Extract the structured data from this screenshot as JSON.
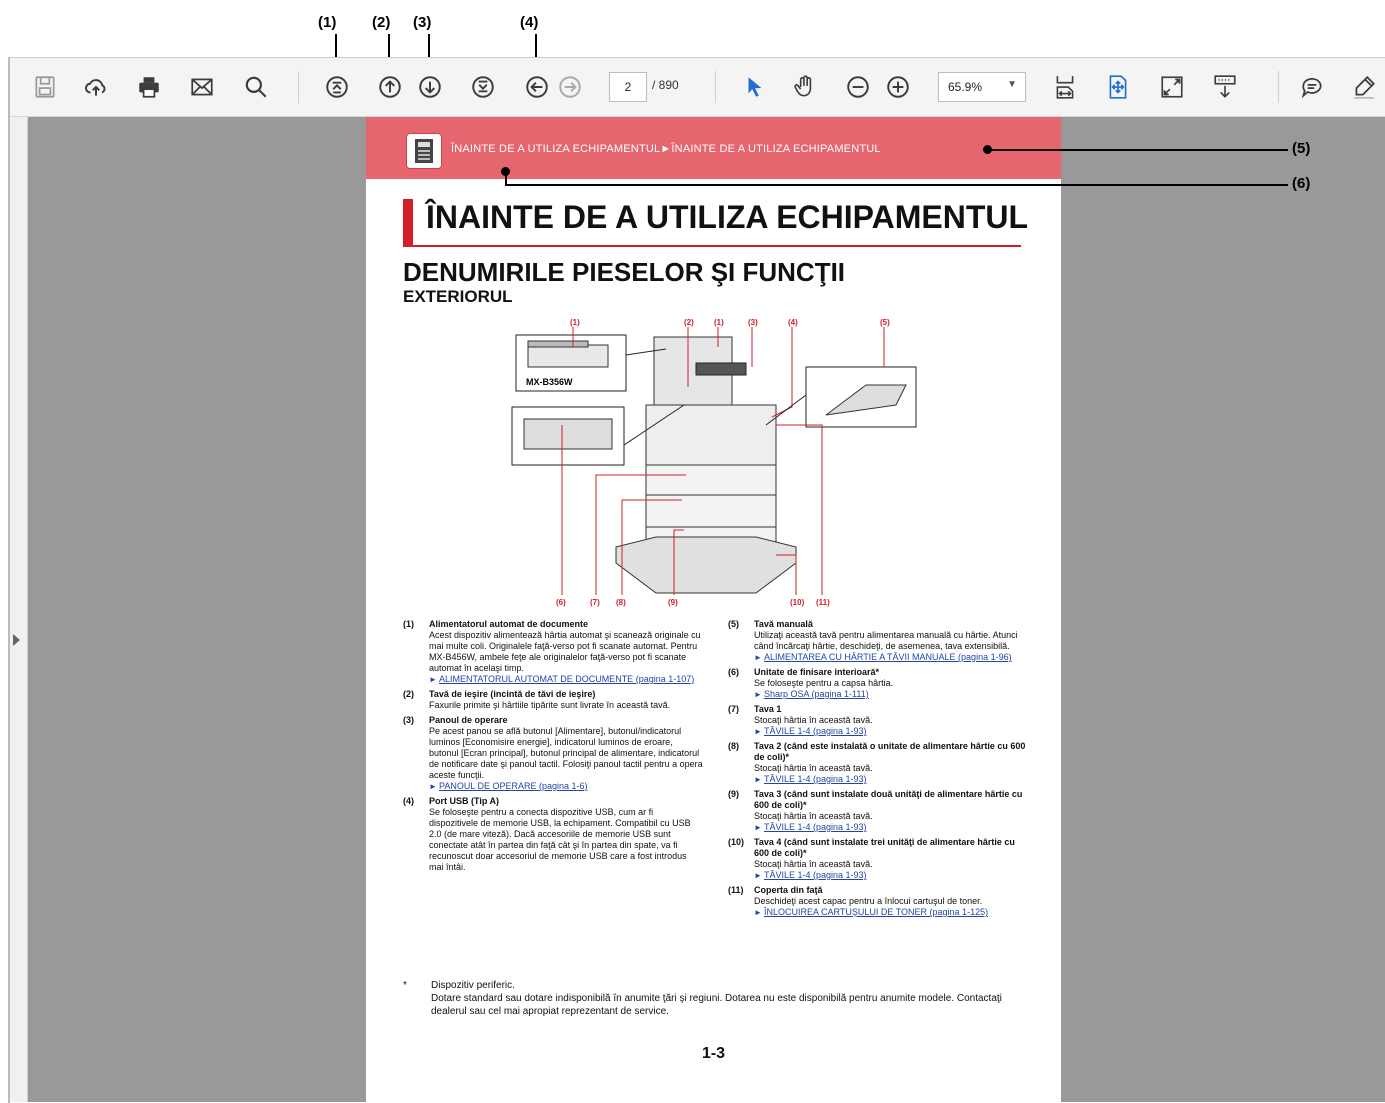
{
  "callouts": {
    "c1": "(1)",
    "c2": "(2)",
    "c3": "(3)",
    "c4": "(4)",
    "c5": "(5)",
    "c6": "(6)"
  },
  "toolbar": {
    "icons": [
      "save-icon",
      "cloud-upload-icon",
      "print-icon",
      "email-icon",
      "search-icon",
      "first-page-icon",
      "previous-page-icon",
      "next-page-icon",
      "last-page-icon",
      "previous-view-icon",
      "next-view-icon",
      "select-tool-icon",
      "hand-tool-icon",
      "zoom-out-icon",
      "zoom-in-icon",
      "fit-page-icon",
      "fit-width-icon",
      "full-screen-icon",
      "scroll-mode-icon",
      "comment-icon",
      "highlight-icon"
    ],
    "current_page": "2",
    "total_pages": "/ 890",
    "zoom": "65.9%"
  },
  "colors": {
    "header_bar": "#e5666e",
    "title_accent": "#d21f2b",
    "link": "#2246a6",
    "viewer_bg": "#999999",
    "select_tool": "#1f6fd1"
  },
  "document": {
    "breadcrumb": "ÎNAINTE DE A UTILIZA ECHIPAMENTUL►ÎNAINTE DE A UTILIZA ECHIPAMENTUL",
    "title": "ÎNAINTE DE A UTILIZA ECHIPAMENTUL",
    "heading": "DENUMIRILE PIESELOR ŞI FUNCŢII",
    "subheading": "EXTERIORUL",
    "diagram": {
      "model_label": "MX-B356W",
      "top_labels": [
        "(1)",
        "(2)",
        "(1)",
        "(3)",
        "(4)",
        "(5)"
      ],
      "bottom_labels": [
        "(6)",
        "(7)",
        "(8)",
        "(9)",
        "(10)",
        "(11)"
      ]
    },
    "left_items": [
      {
        "num": "(1)",
        "title": "Alimentatorul automat de documente",
        "text": "Acest dispozitiv alimentează hârtia automat şi scanează originale cu mai multe coli. Originalele faţă-verso pot fi scanate automat. Pentru MX-B456W, ambele feţe ale originalelor faţă-verso pot fi scanate automat în acelaşi timp.",
        "link": "ALIMENTATORUL AUTOMAT DE DOCUMENTE (pagina 1-107)"
      },
      {
        "num": "(2)",
        "title": "Tavă de ieşire (incintă de tăvi de ieşire)",
        "text": "Faxurile primite şi hârtiile tipărite sunt livrate în această tavă.",
        "link": ""
      },
      {
        "num": "(3)",
        "title": "Panoul de operare",
        "text": "Pe acest panou se află butonul [Alimentare], butonul/indicatorul luminos [Economisire energie], indicatorul luminos de eroare, butonul [Ecran principal], butonul principal de alimentare, indicatorul de notificare date şi panoul tactil. Folosiţi panoul tactil pentru a opera aceste funcţii.",
        "link": "PANOUL DE OPERARE (pagina 1-6)"
      },
      {
        "num": "(4)",
        "title": "Port USB (Tip A)",
        "text": "Se foloseşte pentru a conecta dispozitive USB, cum ar fi dispozitivele de memorie USB, la echipament. Compatibil cu USB 2.0 (de mare viteză). Dacă accesoriile de memorie USB sunt conectate atât în partea din faţă cât şi în partea din spate, va fi recunoscut doar accesoriul de memorie USB care a fost introdus mai întâi.",
        "link": ""
      }
    ],
    "right_items": [
      {
        "num": "(5)",
        "title": "Tavă manuală",
        "text": "Utilizaţi această tavă pentru alimentarea manuală cu hârtie. Atunci când încărcaţi hârtie, deschideţi, de asemenea, tava extensibilă.",
        "link": "ALIMENTAREA CU HÂRTIE A TĂVII MANUALE (pagina 1-96)"
      },
      {
        "num": "(6)",
        "title": "Unitate de finisare interioară*",
        "text": "Se foloseşte pentru a capsa hârtia.",
        "link": "Sharp OSA (pagina 1-111)"
      },
      {
        "num": "(7)",
        "title": "Tava 1",
        "text": "Stocaţi hârtia în această tavă.",
        "link": "TĂVILE 1-4 (pagina 1-93)"
      },
      {
        "num": "(8)",
        "title": "Tava 2 (când este instalată o unitate de alimentare hârtie cu 600 de coli)*",
        "text": "Stocaţi hârtia în această tavă.",
        "link": "TĂVILE 1-4 (pagina 1-93)"
      },
      {
        "num": "(9)",
        "title": "Tava 3 (când sunt instalate două unităţi de alimentare hârtie cu 600 de coli)*",
        "text": "Stocaţi hârtia în această tavă.",
        "link": "TĂVILE 1-4 (pagina 1-93)"
      },
      {
        "num": "(10)",
        "title": "Tava 4 (când sunt instalate trei unităţi de alimentare hârtie cu 600 de coli)*",
        "text": "Stocaţi hârtia în această tavă.",
        "link": "TĂVILE 1-4 (pagina 1-93)"
      },
      {
        "num": "(11)",
        "title": "Coperta din faţă",
        "text": "Deschideţi acest capac pentru a înlocui cartuşul de toner.",
        "link": "ÎNLOCUIREA CARTUŞULUI DE TONER (pagina 1-125)"
      }
    ],
    "footnote_mark": "*",
    "footnote": "Dispozitiv periferic.\nDotare standard sau dotare indisponibilă în anumite ţări şi regiuni. Dotarea nu este disponibilă pentru anumite modele. Contactaţi dealerul sau cel mai apropiat reprezentant de service.",
    "page_number": "1-3"
  }
}
